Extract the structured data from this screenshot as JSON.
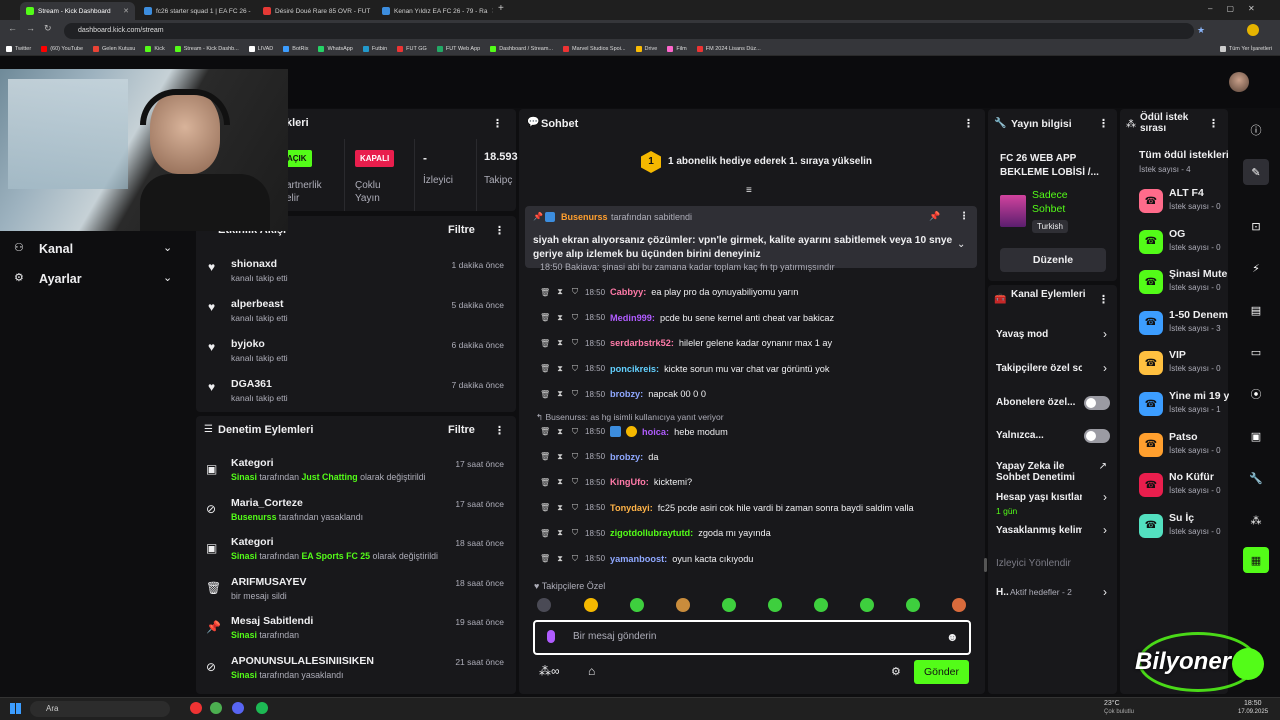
{
  "browser": {
    "tabs": [
      {
        "title": "Stream - Kick Dashboard",
        "color": "#53fc18"
      },
      {
        "title": "fc26 starter squad 1 | EA FC 26 -",
        "color": "#3c8dde"
      },
      {
        "title": "Désiré Doué Rare 85 OVR - FUT",
        "color": "#e53935"
      },
      {
        "title": "Kenan Yıldız EA FC 26 - 79 - Ra",
        "color": "#3c8dde"
      }
    ],
    "url": "dashboard.kick.com/stream",
    "bookmarks": [
      "Twitter",
      "(60) YouTube",
      "Gelen Kutusu",
      "Kick",
      "Stream - Kick Dashb...",
      "LIVAD",
      "BotRix",
      "WhatsApp",
      "Futbin",
      "FUT GG",
      "FUT Web App",
      "Dashboard / Stream...",
      "Marvel Studios Spoi...",
      "Drive",
      "Film",
      "FM 2024 Lisans Düz..."
    ],
    "all_bookmarks": "Tüm Yer İşaretleri"
  },
  "left_nav": {
    "items": [
      {
        "label": "Kanal"
      },
      {
        "label": "Ayarlar"
      }
    ]
  },
  "session_panel": {
    "title_fragment": "kleri",
    "badges": [
      {
        "label": "AÇIK",
        "color": "#53fc18"
      },
      {
        "label": "KAPALI",
        "color": "#e91e4d"
      }
    ],
    "stats": [
      {
        "value": "",
        "label": "artnerlik\nelir"
      },
      {
        "value": "",
        "label": "Çoklu\nYayın"
      },
      {
        "value": "-",
        "label": "İzleyici"
      },
      {
        "value": "18.593",
        "label": "Takipç"
      }
    ]
  },
  "activity": {
    "title": "Etkinlik Akışı",
    "filter": "Filtre",
    "items": [
      {
        "user": "shionaxd",
        "action": "kanalı takip etti",
        "time": "1 dakika önce"
      },
      {
        "user": "alperbeast",
        "action": "kanalı takip etti",
        "time": "5 dakika önce"
      },
      {
        "user": "byjoko",
        "action": "kanalı takip etti",
        "time": "6 dakika önce"
      },
      {
        "user": "DGA361",
        "action": "kanalı takip etti",
        "time": "7 dakika önce"
      }
    ]
  },
  "moderation": {
    "title": "Denetim Eylemleri",
    "filter": "Filtre",
    "items": [
      {
        "title": "Kategori",
        "actor": "Sinasi",
        "mid": " tarafından ",
        "target": "Just Chatting",
        "tail": " olarak değiştirildi",
        "time": "17 saat önce",
        "icon": "category-icon"
      },
      {
        "title": "Maria_Corteze",
        "actor": "Busenurss",
        "mid": " tarafından yasaklandı",
        "target": "",
        "tail": "",
        "time": "17 saat önce",
        "icon": "ban-icon"
      },
      {
        "title": "Kategori",
        "actor": "Sinasi",
        "mid": " tarafından ",
        "target": "EA Sports FC 25",
        "tail": " olarak değiştirildi",
        "time": "18 saat önce",
        "icon": "category-icon"
      },
      {
        "title": "ARIFMUSAYEV",
        "actor": "",
        "mid": "bir mesajı sildi",
        "target": "",
        "tail": "",
        "time": "18 saat önce",
        "icon": "trash-icon"
      },
      {
        "title": "Mesaj Sabitlendi",
        "actor": "Sinasi",
        "mid": " tarafından",
        "target": "",
        "tail": "",
        "time": "19 saat önce",
        "icon": "pin-icon"
      },
      {
        "title": "APONUNSULALESINIISIKEN",
        "actor": "Sinasi",
        "mid": " tarafından yasaklandı",
        "target": "",
        "tail": "",
        "time": "21 saat önce",
        "icon": "ban-icon"
      }
    ]
  },
  "chat": {
    "title": "Sohbet",
    "banner": "1 abonelik hediye ederek 1. sıraya yükselin",
    "banner_badge": "1",
    "pinned": {
      "by_user": "Busenurss",
      "by_text": "tarafından sabitlendi",
      "message": "siyah ekran alıyorsanız çözümler: vpn'le girmek, kalite ayarını sabitlemek veya 10 snye geriye alıp izlemek bu üçünden birini deneyiniz"
    },
    "partial_line": "18:50 Bakiava: şinasi abi bu zamana kadar toplam kaç fn tp yatırmışsındır",
    "messages": [
      {
        "time": "18:50",
        "user": "Cabbyy",
        "color": "#ff7aa8",
        "text": "ea play pro da oynuyabiliyomu yarın"
      },
      {
        "time": "18:50",
        "user": "Medin999",
        "color": "#b05cff",
        "text": "pcde bu sene kernel anti cheat var bakicaz"
      },
      {
        "time": "18:50",
        "user": "serdarbstrk52",
        "color": "#ff7aa8",
        "text": "hileler gelene kadar oynanır max 1 ay"
      },
      {
        "time": "18:50",
        "user": "poncikreis",
        "color": "#62d0ff",
        "text": "kickte sorun mu var chat var görüntü yok"
      },
      {
        "time": "18:50",
        "user": "brobzy",
        "color": "#8fa8ff",
        "text": "napcak 00 0 0"
      }
    ],
    "reply_note": "Busenurss: as hg isimli kullanıcıya yanıt veriyor",
    "messages2": [
      {
        "time": "18:50",
        "user": "hoica",
        "color": "#b05cff",
        "text": "hebe modum",
        "badges": true
      },
      {
        "time": "18:50",
        "user": "brobzy",
        "color": "#8fa8ff",
        "text": "da"
      },
      {
        "time": "18:50",
        "user": "KingUfo",
        "color": "#ff7aa8",
        "text": "kicktemi?"
      },
      {
        "time": "18:50",
        "user": "Tonydayi",
        "color": "#ffb347",
        "text": "fc25 pcde asiri cok hile vardi bi zaman sonra baydi saldim valla"
      },
      {
        "time": "18:50",
        "user": "zigotdollubraytutd",
        "color": "#53fc18",
        "text": "zgoda mı yayında"
      },
      {
        "time": "18:50",
        "user": "yamanboost",
        "color": "#8fa8ff",
        "text": "oyun kacta cıkıyodu"
      }
    ],
    "followers_only": "Takipçilere Özel",
    "input_placeholder": "Bir mesaj gönderin",
    "send": "Gönder"
  },
  "stream_info": {
    "title": "Yayın bilgisi",
    "stream_title": "FC 26 WEB APP BEKLEME LOBİSİ /...",
    "category": "Sadece Sohbet",
    "language": "Turkish",
    "edit": "Düzenle"
  },
  "channel_actions": {
    "title": "Kanal Eylemleri",
    "items": [
      {
        "label": "Yavaş mod",
        "type": "chevron"
      },
      {
        "label": "Takipçilere özel sol",
        "type": "chevron"
      },
      {
        "label": "Abonelere özel...",
        "type": "toggle"
      },
      {
        "label": "Yalnızca...",
        "type": "toggle"
      },
      {
        "label": "Yapay Zeka ile Sohbet Denetimi",
        "type": "external"
      },
      {
        "label": "Hesap yaşı kısıtlam",
        "sub": "1 gün",
        "type": "chevron"
      },
      {
        "label": "Yasaklanmış kelime",
        "type": "chevron"
      },
      {
        "label": "İzleyici Yönlendir",
        "type": "none"
      },
      {
        "label": "H..",
        "sub": "Aktif hedefler - 2",
        "type": "chevron"
      }
    ]
  },
  "rewards": {
    "title": "Ödül istek sırası",
    "all": "Tüm ödül istekleri",
    "count": "İstek sayısı - 4",
    "items": [
      {
        "name": "ALT F4",
        "count": "İstek sayısı - 0",
        "color": "#ff6b8b"
      },
      {
        "name": "OG",
        "count": "İstek sayısı - 0",
        "color": "#53fc18"
      },
      {
        "name": "Şinasi Mute",
        "count": "İstek sayısı - 0",
        "color": "#53fc18"
      },
      {
        "name": "1-50 Denem",
        "count": "İstek sayısı - 3",
        "color": "#3c9dff"
      },
      {
        "name": "VIP",
        "count": "İstek sayısı - 0",
        "color": "#ffc040"
      },
      {
        "name": "Yine mi 19 y",
        "count": "İstek sayısı - 1",
        "color": "#3c9dff"
      },
      {
        "name": "Patso",
        "count": "İstek sayısı - 0",
        "color": "#ff9f2e"
      },
      {
        "name": "No Küfür",
        "count": "İstek sayısı - 0",
        "color": "#e91e4d"
      },
      {
        "name": "Su İç",
        "count": "İstek sayısı - 0",
        "color": "#53e0c0"
      }
    ]
  },
  "watermark": "Bilyoner",
  "taskbar": {
    "search": "Ara",
    "weather": "23°C",
    "weather_sub": "Çok bulutlu",
    "time": "18:50",
    "date": "17.09.2025"
  }
}
